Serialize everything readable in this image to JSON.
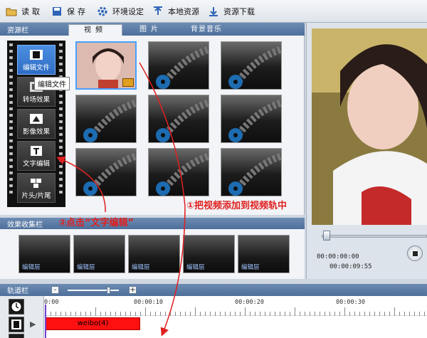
{
  "toolbar": {
    "open": "读取",
    "save": "保存",
    "settings": "环境设定",
    "local": "本地资源",
    "download": "资源下载"
  },
  "resource_panel": {
    "title": "资源栏",
    "tabs": [
      "视频",
      "图片",
      "背景音乐"
    ],
    "active_tab": "视频",
    "side_menu": [
      {
        "label": "编辑文件",
        "icon": "film-icon"
      },
      {
        "label": "转场效果",
        "icon": "transition-icon"
      },
      {
        "label": "影像效果",
        "icon": "image-effect-icon"
      },
      {
        "label": "文字编辑",
        "icon": "text-icon"
      },
      {
        "label": "片头/片尾",
        "icon": "intro-outro-icon"
      }
    ],
    "tooltip": "编辑文件"
  },
  "effects_panel": {
    "title": "效果收集栏",
    "items": [
      "编辑层",
      "编辑层",
      "编辑层",
      "编辑层",
      "编辑层"
    ]
  },
  "preview": {
    "time_current": "00:00:00:00",
    "time_total": "00:00:09:55"
  },
  "timeline": {
    "title": "轨道栏",
    "zoom_out": "-",
    "zoom_in": "+",
    "ruler": [
      "0:00",
      "00:00:10",
      "00:00:20",
      "00:00:30"
    ],
    "clip_label": "weibo(4)"
  },
  "annotations": {
    "step1": "①把视频添加到视频轨中",
    "step2": "②点击“文字编辑”"
  },
  "colors": {
    "accent": "#4a8fe0",
    "annotation": "#e02020",
    "clip": "#ff1010",
    "header": "#4e6f9b"
  }
}
